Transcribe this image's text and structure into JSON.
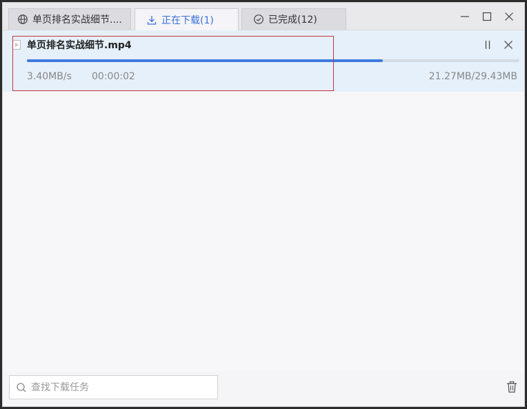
{
  "tabs": [
    {
      "label": "单页排名实战细节....",
      "icon": "globe-icon",
      "active": false
    },
    {
      "label": "正在下载(1)",
      "icon": "download-icon",
      "active": true
    },
    {
      "label": "已完成(12)",
      "icon": "check-circle-icon",
      "active": false
    }
  ],
  "window_controls": [
    "minimize-icon",
    "maximize-icon",
    "close-icon"
  ],
  "download": {
    "filename": "单页排名实战细节.mp4",
    "speed": "3.40MB/s",
    "elapsed": "00:00:02",
    "size": "21.27MB/29.43MB",
    "progress_fraction": 0.723
  },
  "search": {
    "placeholder": "查找下载任务",
    "value": ""
  },
  "colors": {
    "accent": "#3e7be0",
    "highlight_border": "#c8333c",
    "row_bg": "#e5f0fa"
  }
}
